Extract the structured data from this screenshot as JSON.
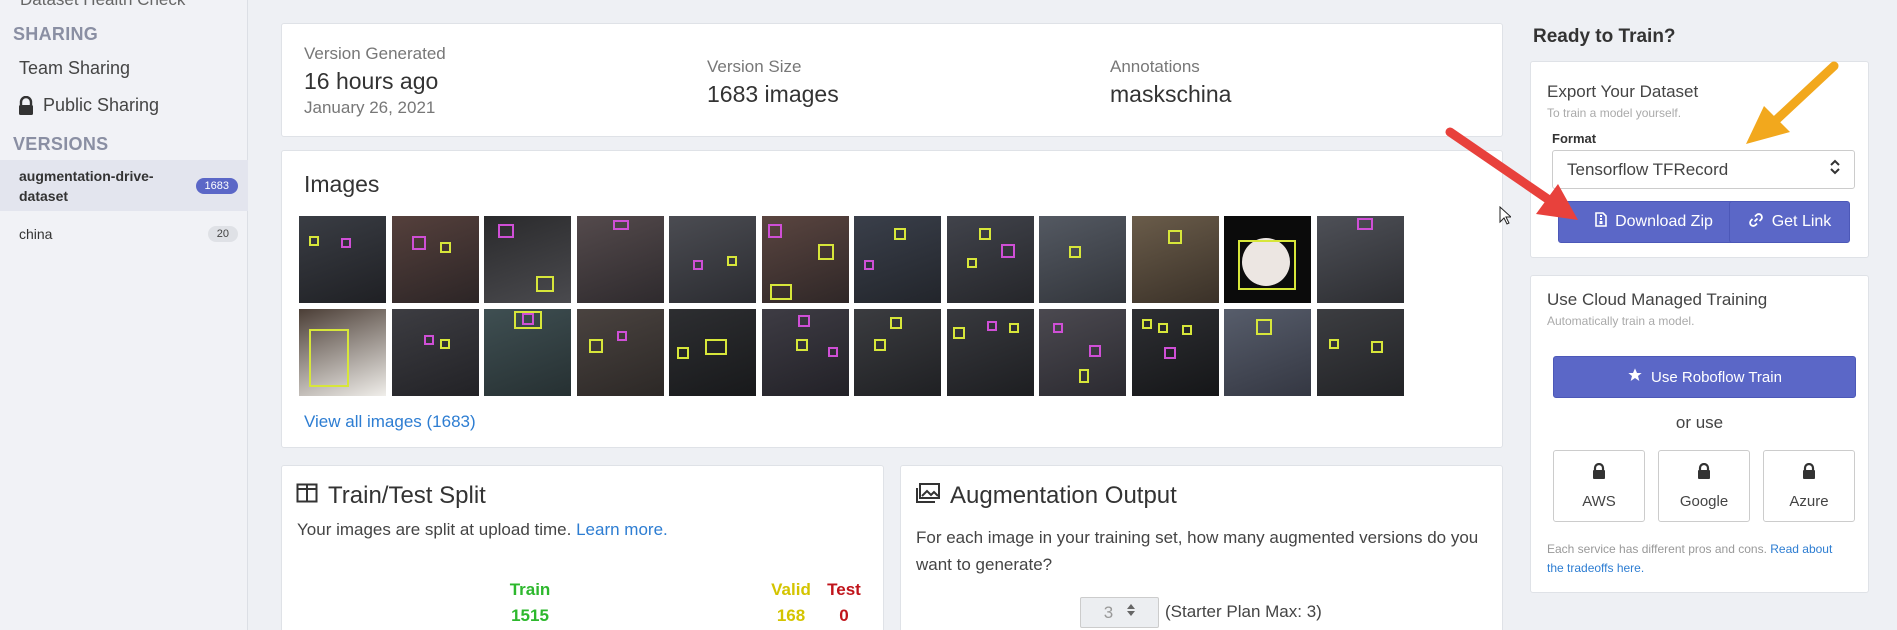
{
  "sidebar": {
    "cut_item": "Dataset Health Check",
    "sharing_heading": "SHARING",
    "team_sharing": "Team Sharing",
    "public_sharing": "Public Sharing",
    "versions_heading": "VERSIONS",
    "versions": [
      {
        "name": "augmentation-drive-dataset",
        "count": "1683",
        "active": true
      },
      {
        "name": "china",
        "count": "20",
        "active": false
      }
    ]
  },
  "version_info": {
    "generated_label": "Version Generated",
    "generated_value": "16 hours ago",
    "generated_date": "January 26, 2021",
    "size_label": "Version Size",
    "size_value": "1683 images",
    "annotations_label": "Annotations",
    "annotations_value": "maskschina"
  },
  "images": {
    "title": "Images",
    "view_all": "View all images (1683)"
  },
  "split": {
    "title": "Train/Test Split",
    "description": "Your images are split at upload time.",
    "learn_more": "Learn more.",
    "train_label": "Train",
    "train_value": "1515",
    "valid_label": "Valid",
    "valid_value": "168",
    "test_label": "Test",
    "test_value": "0",
    "colors": {
      "train": "#2db82d",
      "valid": "#d4c400",
      "test": "#c0141b"
    }
  },
  "augmentation": {
    "title": "Augmentation Output",
    "description": "For each image in your training set, how many augmented versions do you want to generate?",
    "stepper_value": "3",
    "plan_note": "(Starter Plan Max: 3)"
  },
  "right_panel": {
    "title": "Ready to Train?",
    "export": {
      "title": "Export Your Dataset",
      "subtitle": "To train a model yourself.",
      "format_label": "Format",
      "format_value": "Tensorflow TFRecord",
      "download_label": "Download Zip",
      "get_link_label": "Get Link"
    },
    "cloud": {
      "title": "Use Cloud Managed Training",
      "subtitle": "Automatically train a model.",
      "roboflow_train_label": "Use Roboflow Train",
      "or_use": "or use",
      "providers": [
        "AWS",
        "Google",
        "Azure"
      ],
      "note_text": "Each service has different pros and cons.",
      "note_link": "Read about the tradeoffs here."
    }
  },
  "colors": {
    "accent": "#5b67c7",
    "link": "#2d7dd2",
    "arrow_red": "#e8413c",
    "arrow_orange": "#f2a81d"
  },
  "icons": [
    "lock-icon",
    "split-icon",
    "images-icon",
    "file-zip-icon",
    "link-icon",
    "star-icon",
    "chevron-updown-icon",
    "cursor-icon"
  ]
}
